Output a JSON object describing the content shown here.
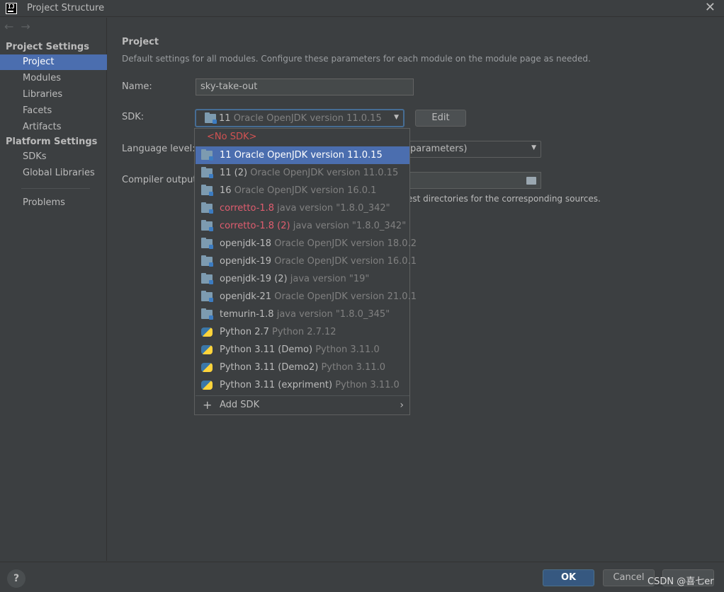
{
  "window": {
    "title": "Project Structure",
    "app_icon_text": "IJ"
  },
  "sidebar": {
    "project_settings_header": "Project Settings",
    "project_settings_items": [
      {
        "label": "Project",
        "selected": true
      },
      {
        "label": "Modules"
      },
      {
        "label": "Libraries"
      },
      {
        "label": "Facets"
      },
      {
        "label": "Artifacts"
      }
    ],
    "platform_settings_header": "Platform Settings",
    "platform_settings_items": [
      {
        "label": "SDKs"
      },
      {
        "label": "Global Libraries"
      }
    ],
    "problems_label": "Problems"
  },
  "main": {
    "title": "Project",
    "description": "Default settings for all modules. Configure these parameters for each module on the module page as needed.",
    "name_label": "Name:",
    "name_value": "sky-take-out",
    "sdk_label": "SDK:",
    "sdk_selected_name": "11",
    "sdk_selected_detail": "Oracle OpenJDK version 11.0.15",
    "edit_label": "Edit",
    "language_level_label": "Language level:",
    "language_level_visible": "parameters)",
    "compiler_output_label": "Compiler output:",
    "hint_visible": "est directories for the corresponding sources."
  },
  "sdk_popup": {
    "no_sdk": "<No SDK>",
    "items": [
      {
        "name": "11",
        "detail": "Oracle OpenJDK version 11.0.15",
        "icon": "folder-icon",
        "selected": true
      },
      {
        "name": "11 (2)",
        "detail": "Oracle OpenJDK version 11.0.15",
        "icon": "folder-icon"
      },
      {
        "name": "16",
        "detail": "Oracle OpenJDK version 16.0.1",
        "icon": "folder-icon"
      },
      {
        "name": "corretto-1.8",
        "detail": "java version \"1.8.0_342\"",
        "icon": "folder-icon",
        "invalid": true
      },
      {
        "name": "corretto-1.8 (2)",
        "detail": "java version \"1.8.0_342\"",
        "icon": "folder-icon",
        "invalid": true
      },
      {
        "name": "openjdk-18",
        "detail": "Oracle OpenJDK version 18.0.2",
        "icon": "folder-icon"
      },
      {
        "name": "openjdk-19",
        "detail": "Oracle OpenJDK version 16.0.1",
        "icon": "folder-icon"
      },
      {
        "name": "openjdk-19 (2)",
        "detail": "java version \"19\"",
        "icon": "folder-icon"
      },
      {
        "name": "openjdk-21",
        "detail": "Oracle OpenJDK version 21.0.1",
        "icon": "folder-icon"
      },
      {
        "name": "temurin-1.8",
        "detail": "java version \"1.8.0_345\"",
        "icon": "folder-icon"
      },
      {
        "name": "Python 2.7",
        "detail": "Python 2.7.12",
        "icon": "python-icon"
      },
      {
        "name": "Python 3.11 (Demo)",
        "detail": "Python 3.11.0",
        "icon": "python-icon"
      },
      {
        "name": "Python 3.11 (Demo2)",
        "detail": "Python 3.11.0",
        "icon": "python-icon"
      },
      {
        "name": "Python 3.11 (expriment)",
        "detail": "Python 3.11.0",
        "icon": "python-icon"
      }
    ],
    "add_sdk": "Add SDK"
  },
  "footer": {
    "help": "?",
    "ok": "OK",
    "cancel": "Cancel",
    "watermark": "CSDN @喜七er"
  },
  "colors": {
    "background": "#3c3f41",
    "selection": "#4b6eaf",
    "invalid_sdk": "#e05d6f",
    "ok_button": "#365880"
  }
}
